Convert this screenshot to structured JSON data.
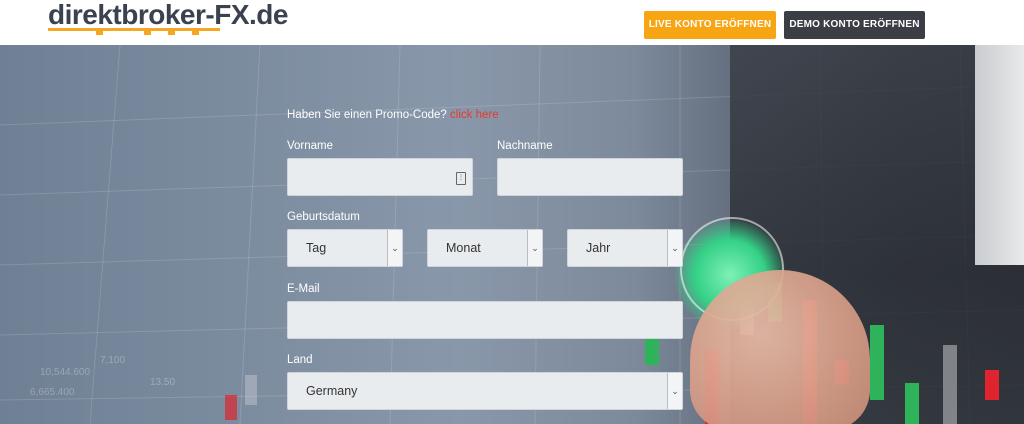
{
  "header": {
    "logo_text": "direktbroker-FX.de",
    "live_button": "LIVE KONTO ERÖFFNEN",
    "demo_button": "DEMO KONTO ERÖFFNEN"
  },
  "colors": {
    "accent_orange": "#f7a512",
    "demo_button_bg": "#3b3e44",
    "link_red": "#e8392b",
    "logo_text": "#3a4250"
  },
  "form": {
    "promo_text": "Haben Sie einen Promo-Code?",
    "promo_link": "click here",
    "first_name_label": "Vorname",
    "last_name_label": "Nachname",
    "birthdate_label": "Geburtsdatum",
    "day_select": "Tag",
    "month_select": "Monat",
    "year_select": "Jahr",
    "email_label": "E-Mail",
    "country_label": "Land",
    "country_select": "Germany"
  },
  "icons": {
    "chevron": "chevron-down-icon",
    "autofill": "autofill-icon"
  }
}
